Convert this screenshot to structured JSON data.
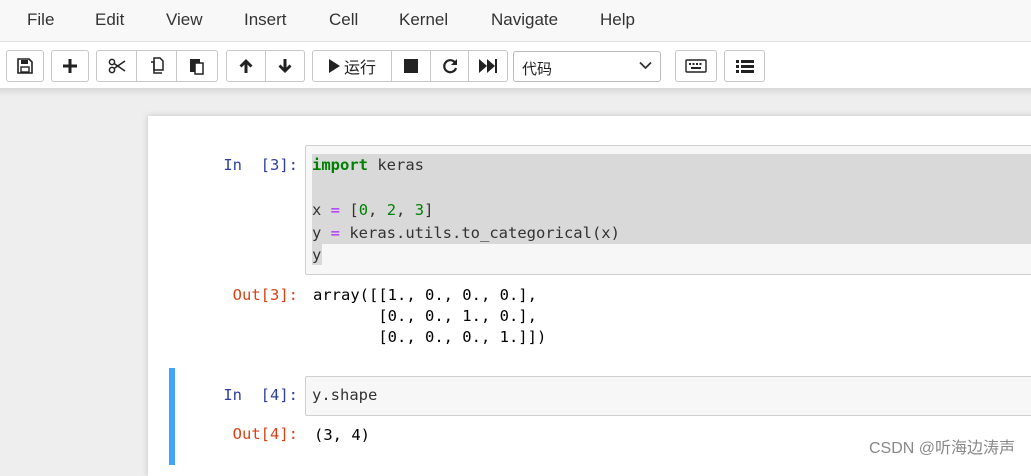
{
  "menubar": {
    "items": [
      "File",
      "Edit",
      "View",
      "Insert",
      "Cell",
      "Kernel",
      "Navigate",
      "Help"
    ]
  },
  "toolbar": {
    "run_label": "运行",
    "cell_type": "代码",
    "icons": [
      "save-icon",
      "plus-icon",
      "scissors-icon",
      "copy-icon",
      "paste-icon",
      "arrow-up-icon",
      "arrow-down-icon",
      "run-icon",
      "stop-icon",
      "restart-icon",
      "fast-forward-icon",
      "keyboard-icon",
      "list-icon"
    ]
  },
  "cells": [
    {
      "in_prompt": "In  [3]:",
      "code_lines": [
        {
          "parts": [
            {
              "t": "import",
              "c": "kw"
            },
            {
              "t": " keras",
              "c": ""
            }
          ]
        },
        {
          "parts": []
        },
        {
          "parts": [
            {
              "t": "x ",
              "c": ""
            },
            {
              "t": "=",
              "c": "op"
            },
            {
              "t": " [",
              "c": ""
            },
            {
              "t": "0",
              "c": "num"
            },
            {
              "t": ", ",
              "c": ""
            },
            {
              "t": "2",
              "c": "num"
            },
            {
              "t": ", ",
              "c": ""
            },
            {
              "t": "3",
              "c": "num"
            },
            {
              "t": "]",
              "c": ""
            }
          ]
        },
        {
          "parts": [
            {
              "t": "y ",
              "c": ""
            },
            {
              "t": "=",
              "c": "op"
            },
            {
              "t": " keras.utils.to_categorical(x)",
              "c": ""
            }
          ]
        },
        {
          "parts": [
            {
              "t": "y",
              "c": ""
            }
          ]
        }
      ],
      "out_prompt": "Out[3]:",
      "output": "array([[1., 0., 0., 0.],\n       [0., 0., 1., 0.],\n       [0., 0., 0., 1.]])"
    },
    {
      "in_prompt": "In  [4]:",
      "code_lines": [
        {
          "parts": [
            {
              "t": "y.shape",
              "c": ""
            }
          ]
        }
      ],
      "out_prompt": "Out[4]:",
      "output": "(3, 4)"
    }
  ],
  "watermark": "CSDN @听海边涛声",
  "colors": {
    "selected_cell_bar": "#42a5f5",
    "in_prompt": "#303f9f",
    "out_prompt": "#d84315",
    "keyword": "#008000"
  }
}
